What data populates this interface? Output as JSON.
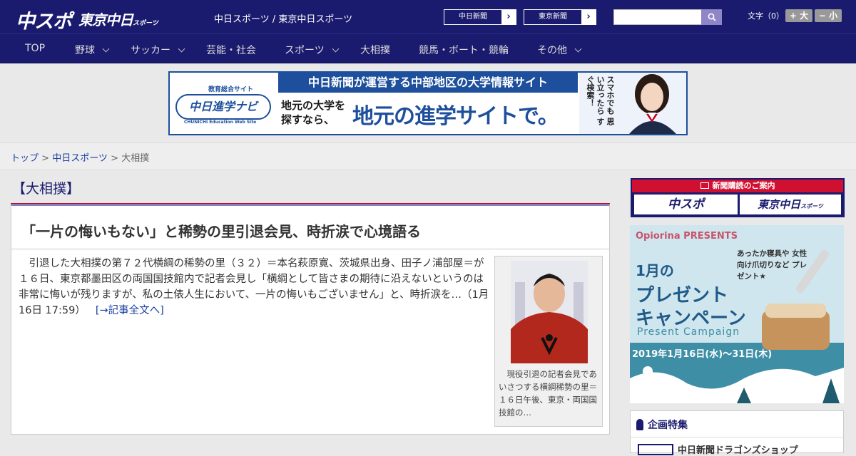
{
  "header": {
    "logo_main": "中スポ",
    "logo_tokyo": "東京中日",
    "logo_tokyo_sub": "スポーツ",
    "site_title": "中日スポーツ / 東京中日スポーツ",
    "ext_links": [
      "中日新聞",
      "東京新聞"
    ],
    "search_placeholder": "",
    "font_label": "文字（0）",
    "font_bigger": "+ 大",
    "font_smaller": "− 小"
  },
  "nav": {
    "items": [
      {
        "label": "TOP",
        "has_menu": false
      },
      {
        "label": "野球",
        "has_menu": true
      },
      {
        "label": "サッカー",
        "has_menu": true
      },
      {
        "label": "芸能・社会",
        "has_menu": false
      },
      {
        "label": "スポーツ",
        "has_menu": true
      },
      {
        "label": "大相撲",
        "has_menu": false
      },
      {
        "label": "競馬・ボート・競輪",
        "has_menu": false
      },
      {
        "label": "その他",
        "has_menu": true
      }
    ]
  },
  "banner": {
    "left_logo": "中日進学ナビ",
    "left_tag": "教育総合サイト",
    "left_sub": "CHUNICHI Education Web Site",
    "top_text": "中日新聞が運営する中部地区の大学情報サイト",
    "bottom_small": "地元の大学を\n探すなら、",
    "bottom_big": "地元の進学サイトで。",
    "right_text": "スマホでも 思い立ったら すぐ検索！"
  },
  "breadcrumb": {
    "home": "トップ",
    "section": "中日スポーツ",
    "current": "大相撲"
  },
  "section_label": "【大相撲】",
  "article": {
    "title": "「一片の悔いもない」と稀勢の里引退会見、時折涙で心境語る",
    "body": "　引退した大相撲の第７２代横綱の稀勢の里（３２）＝本名萩原寛、茨城県出身、田子ノ浦部屋＝が１６日、東京都墨田区の両国国技館内で記者会見し「横綱として皆さまの期待に沿えないというのは非常に悔いが残りますが、私の土俵人生において、一片の悔いもございません」と、時折涙を…（1月16日 17:59）",
    "more_link": "[→記事全文へ]",
    "photo_caption": "　現役引退の記者会見であいさつする横綱稀勢の里＝１６日午後、東京・両国国技館の…"
  },
  "sidebar": {
    "subscribe_head": "新聞購読のご案内",
    "subscribe_logos": [
      "中スポ",
      "東京中日"
    ],
    "subscribe_logo_sub": "スポーツ",
    "ad": {
      "brand": "Opiorina PRESENTS",
      "tagline": "あったか寝具や 女性向け爪切りなど プレゼント★",
      "headline1": "1月の",
      "headline2": "プレゼント",
      "headline3": "キャンペーン",
      "sub": "Present Campaign",
      "dates": "2019年1月16日(水)〜31日(木)"
    },
    "feature_head": "企画特集",
    "feature_item": "中日新聞ドラゴンズショップ"
  },
  "colors": {
    "navy": "#1a1a6e",
    "accent_red": "#c8001e",
    "link": "#1a3fa0",
    "banner_blue": "#1d4f9c"
  }
}
